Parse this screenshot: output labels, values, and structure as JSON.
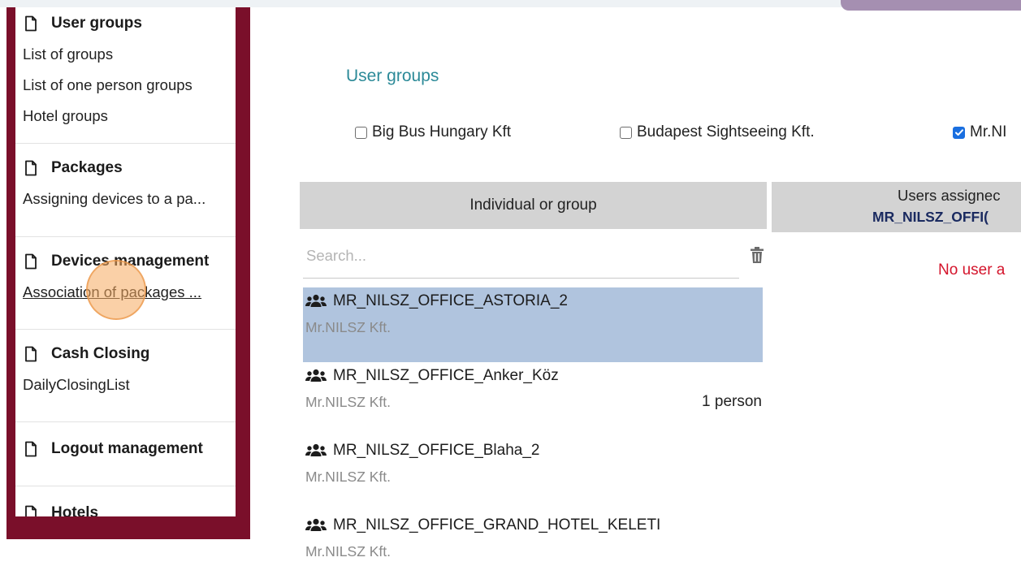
{
  "sidebar": {
    "sections": [
      {
        "title": "User groups",
        "items": [
          "List of groups",
          "List of one person groups",
          "Hotel groups"
        ]
      },
      {
        "title": "Packages",
        "items": [
          "Assigning devices to a pa..."
        ]
      },
      {
        "title": "Devices management",
        "items": [
          "Association of packages ..."
        ]
      },
      {
        "title": "Cash Closing",
        "items": [
          "DailyClosingList"
        ]
      },
      {
        "title": "Logout management",
        "items": []
      },
      {
        "title": "Hotels",
        "items": []
      }
    ]
  },
  "main": {
    "heading": "User groups",
    "companies": [
      {
        "label": "Big Bus Hungary Kft",
        "checked": false
      },
      {
        "label": "Budapest Sightseeing Kft.",
        "checked": false
      },
      {
        "label": "Mr.NI",
        "checked": true
      }
    ],
    "left_column_header": "Individual or group",
    "right_column_header": {
      "line1": "Users assignec",
      "line2": "MR_NILSZ_OFFI("
    },
    "search": {
      "placeholder": "Search..."
    },
    "no_user_text": "No user a",
    "groups": [
      {
        "name": "MR_NILSZ_OFFICE_ASTORIA_2",
        "company": "Mr.NILSZ Kft.",
        "count": "",
        "selected": true
      },
      {
        "name": "MR_NILSZ_OFFICE_Anker_Köz",
        "company": "Mr.NILSZ Kft.",
        "count": "1 person",
        "selected": false
      },
      {
        "name": "MR_NILSZ_OFFICE_Blaha_2",
        "company": "Mr.NILSZ Kft.",
        "count": "",
        "selected": false
      },
      {
        "name": "MR_NILSZ_OFFICE_GRAND_HOTEL_KELETI",
        "company": "Mr.NILSZ Kft.",
        "count": "",
        "selected": false
      }
    ]
  },
  "colors": {
    "sidebar_frame": "#7a0f2a",
    "heading": "#2c8a98",
    "selected_row": "#b0c4de",
    "no_user": "#d4142b",
    "header_bg": "#d3d3d3"
  }
}
